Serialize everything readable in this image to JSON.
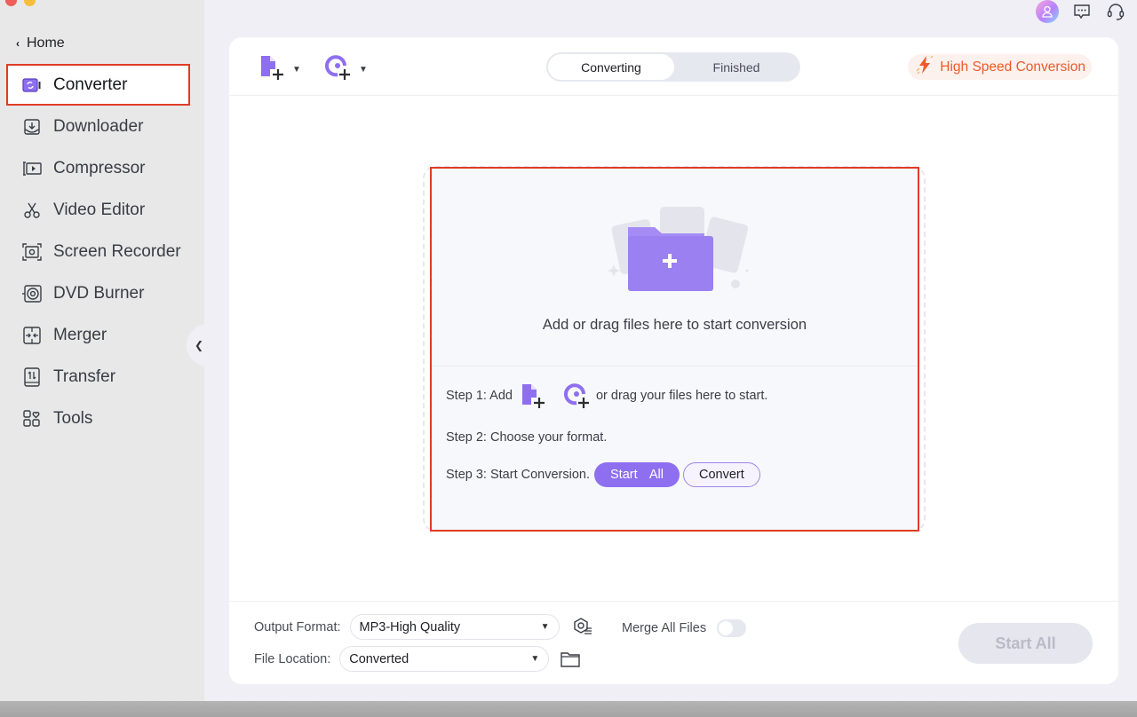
{
  "window": {
    "traffic_lights": [
      "close",
      "minimize"
    ]
  },
  "sidebar": {
    "home_label": "Home",
    "items": [
      {
        "label": "Converter",
        "icon": "converter-icon",
        "active": true
      },
      {
        "label": "Downloader",
        "icon": "downloader-icon",
        "active": false
      },
      {
        "label": "Compressor",
        "icon": "compressor-icon",
        "active": false
      },
      {
        "label": "Video Editor",
        "icon": "scissors-icon",
        "active": false
      },
      {
        "label": "Screen Recorder",
        "icon": "screen-recorder-icon",
        "active": false
      },
      {
        "label": "DVD Burner",
        "icon": "dvd-icon",
        "active": false
      },
      {
        "label": "Merger",
        "icon": "merger-icon",
        "active": false
      },
      {
        "label": "Transfer",
        "icon": "transfer-icon",
        "active": false
      },
      {
        "label": "Tools",
        "icon": "tools-icon",
        "active": false
      }
    ]
  },
  "header_icons": [
    "avatar",
    "feedback-icon",
    "support-headset-icon"
  ],
  "toolbar": {
    "add_file_icon": "add-file-icon",
    "add_media_icon": "add-media-icon",
    "tabs": [
      {
        "label": "Converting",
        "active": true
      },
      {
        "label": "Finished",
        "active": false
      }
    ],
    "high_speed_label": "High Speed Conversion"
  },
  "dropzone": {
    "title": "Add or drag files here to start conversion",
    "step1_prefix": "Step 1: Add",
    "step1_suffix": "or drag your files here to start.",
    "step2": "Step 2: Choose your format.",
    "step3": "Step 3: Start Conversion.",
    "start_all_label": "Start  All",
    "convert_label": "Convert"
  },
  "bottom": {
    "output_format_label": "Output Format:",
    "output_format_value": "MP3-High Quality",
    "file_location_label": "File Location:",
    "file_location_value": "Converted",
    "merge_label": "Merge All Files",
    "merge_enabled": false,
    "start_all_label": "Start All"
  },
  "colors": {
    "accent": "#8e6ff0",
    "highlight_border": "#e03c25",
    "high_speed": "#ec5a2a"
  }
}
